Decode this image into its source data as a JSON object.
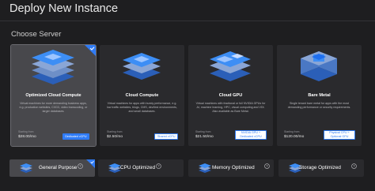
{
  "header": {
    "title": "Deploy New Instance"
  },
  "section": {
    "title": "Choose Server"
  },
  "server_types": [
    {
      "name": "Optimized Cloud Compute",
      "description": "Virtual machines for more demanding business apps, e.g. production websites, CI/CD, video transcoding, or larger databases.",
      "price_label": "Starting from",
      "price": "$28.00/mo",
      "badge": "Dedicated vCPU",
      "selected": true
    },
    {
      "name": "Cloud Compute",
      "description": "Virtual machines for apps with bursty performance, e.g. low traffic websites, blogs, CMS, dev/test environments, and small databases.",
      "price_label": "Starting from",
      "price": "$2.50/mo",
      "badge": "Shared vCPU",
      "selected": false
    },
    {
      "name": "Cloud GPU",
      "description": "Virtual machines with fractional or full NVIDIA GPUs for AI, machine learning, HPC, visual computing and VDI. Also available as Bare Metal.",
      "price_label": "Starting from",
      "price": "$21.50/mo",
      "badge": "NVIDIA GPU + Dedicated vCPU",
      "selected": false
    },
    {
      "name": "Bare Metal",
      "description": "Single tenant bare metal for apps with the most demanding performance or security requirements.",
      "price_label": "Starting from",
      "price": "$120.00/mo",
      "badge": "Physical CPU + Optional GPU",
      "selected": false
    }
  ],
  "optimization_tabs": [
    {
      "label": "General Purpose",
      "icon": "layers-icon",
      "selected": true
    },
    {
      "label": "CPU Optimized",
      "icon": "layers-icon",
      "selected": false
    },
    {
      "label": "Memory Optimized",
      "icon": "layers-icon",
      "selected": false
    },
    {
      "label": "Storage Optimized",
      "icon": "layers-icon",
      "selected": false
    }
  ],
  "colors": {
    "background": "#1e1e20",
    "card": "#2a2a2d",
    "card_selected": "#48484c",
    "accent": "#2f7bf5",
    "icon_blue": "#3d8ef5"
  }
}
